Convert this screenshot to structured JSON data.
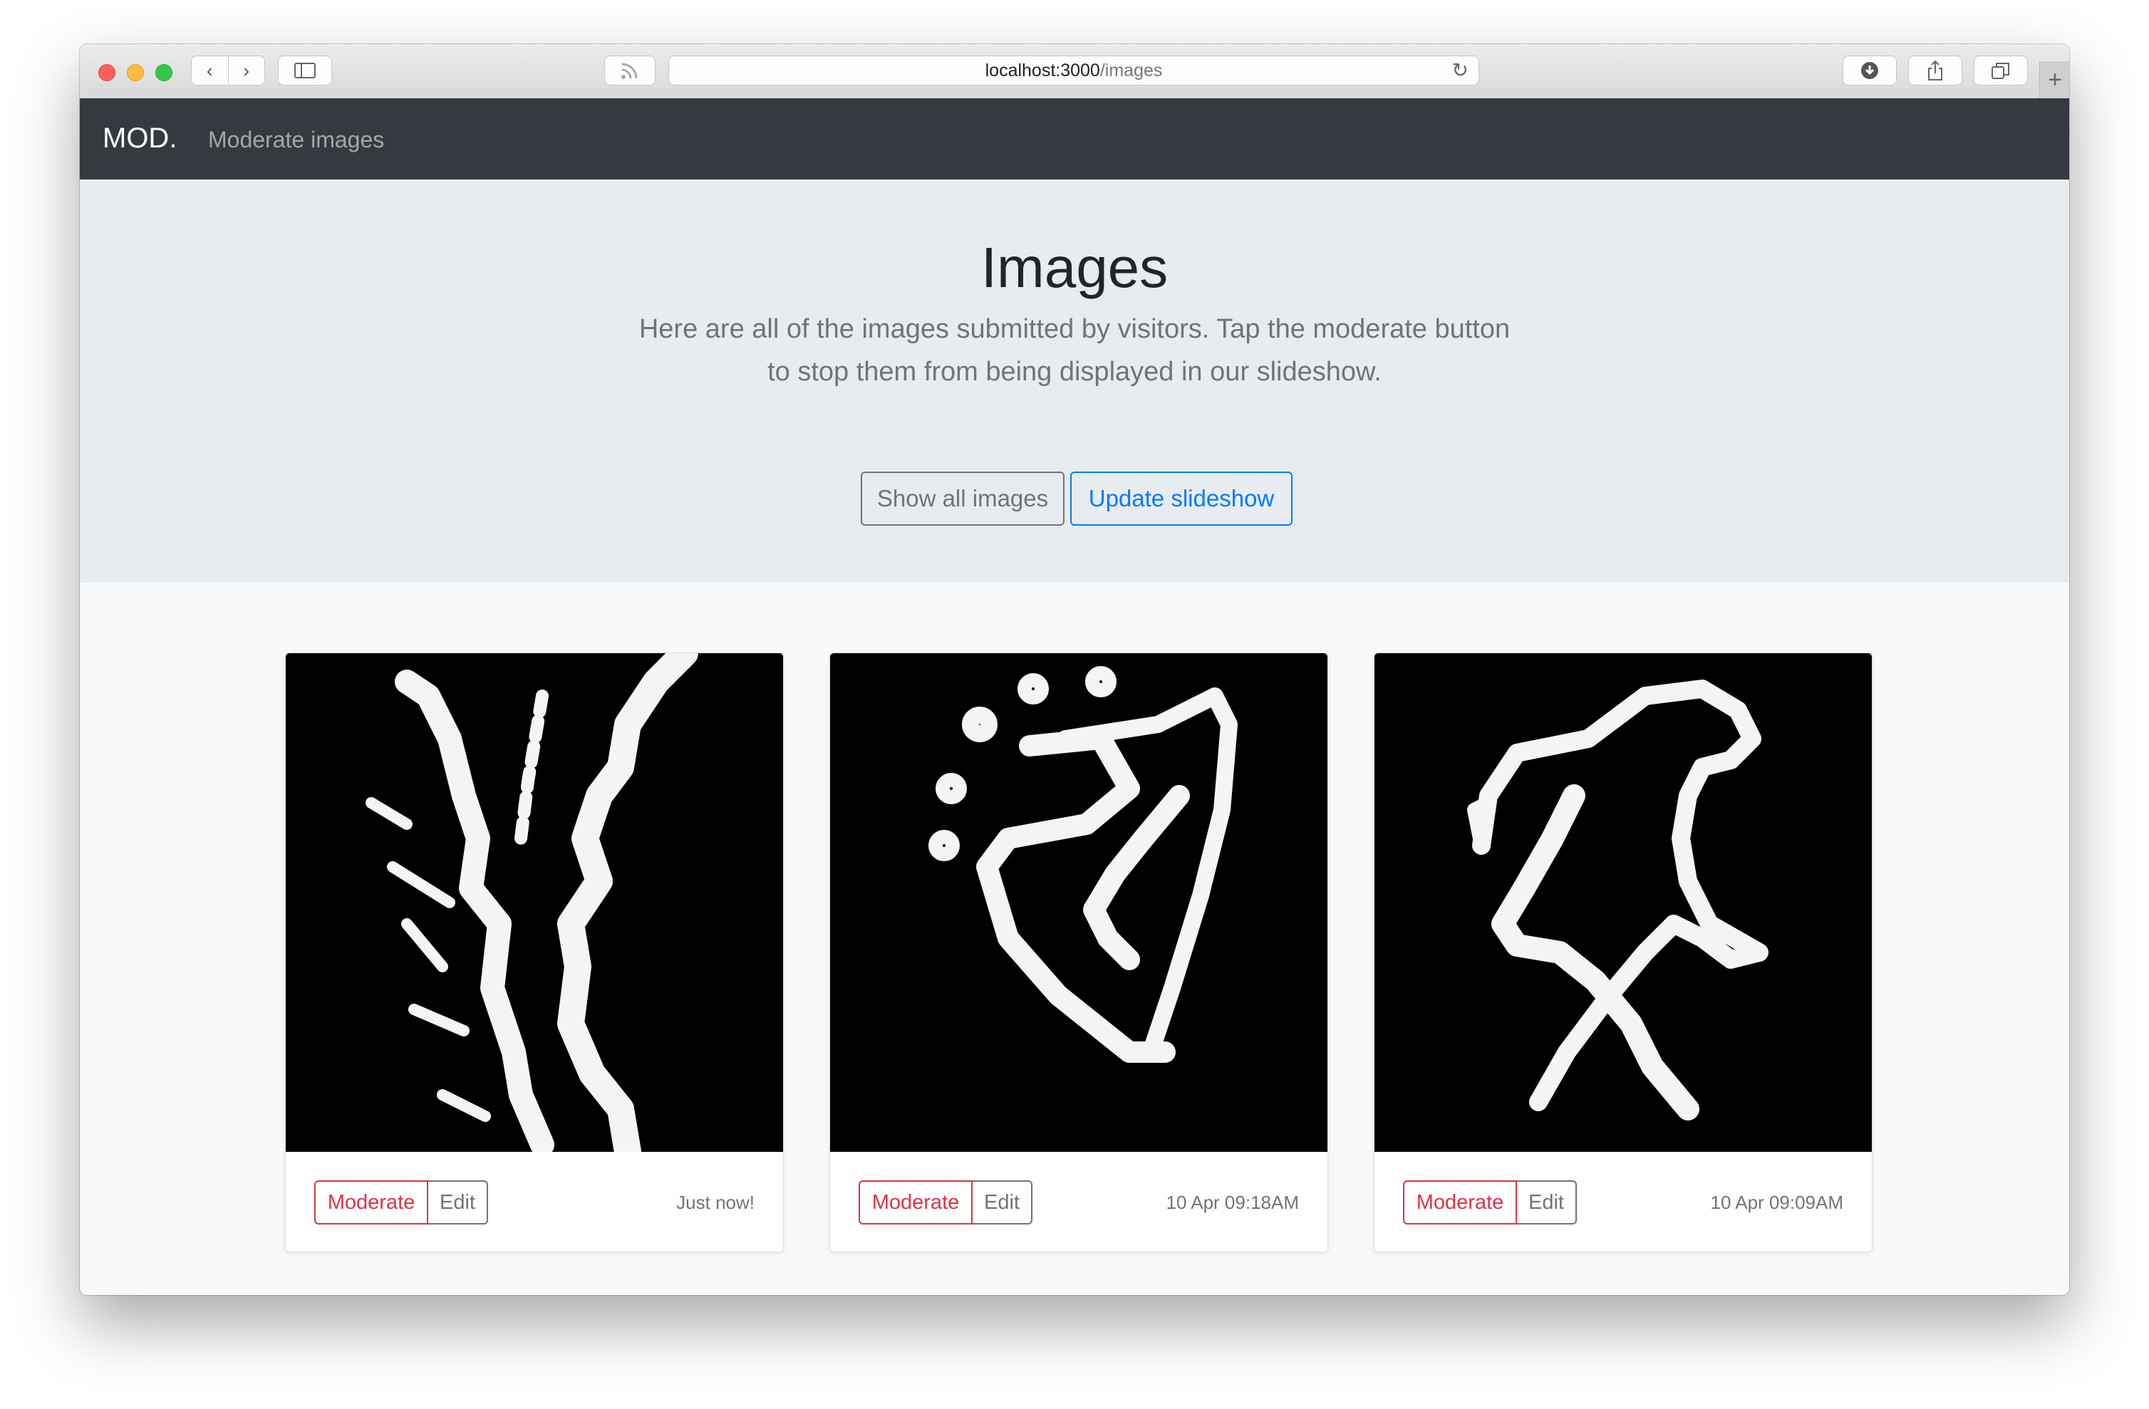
{
  "browser": {
    "url_host": "localhost:3000",
    "url_path": "/images",
    "icons": [
      "back-icon",
      "forward-icon",
      "sidebar-icon",
      "rss-icon",
      "reload-icon",
      "download-icon",
      "share-icon",
      "tabs-icon",
      "new-tab-icon"
    ]
  },
  "navbar": {
    "brand": "MOD.",
    "link": "Moderate images"
  },
  "jumbotron": {
    "title": "Images",
    "lead_line1": "Here are all of the images submitted by visitors. Tap the moderate button",
    "lead_line2": "to stop them from being displayed in our slideshow.",
    "show_all_label": "Show all images",
    "update_label": "Update slideshow"
  },
  "cards": [
    {
      "moderate_label": "Moderate",
      "edit_label": "Edit",
      "timestamp": "Just now!"
    },
    {
      "moderate_label": "Moderate",
      "edit_label": "Edit",
      "timestamp": "10 Apr 09:18AM"
    },
    {
      "moderate_label": "Moderate",
      "edit_label": "Edit",
      "timestamp": "10 Apr 09:09AM"
    }
  ],
  "colors": {
    "navbar": "#343a40",
    "jumbotron": "#e9ecef",
    "danger": "#dc3545",
    "primary": "#007bff",
    "secondary": "#6c757d"
  }
}
